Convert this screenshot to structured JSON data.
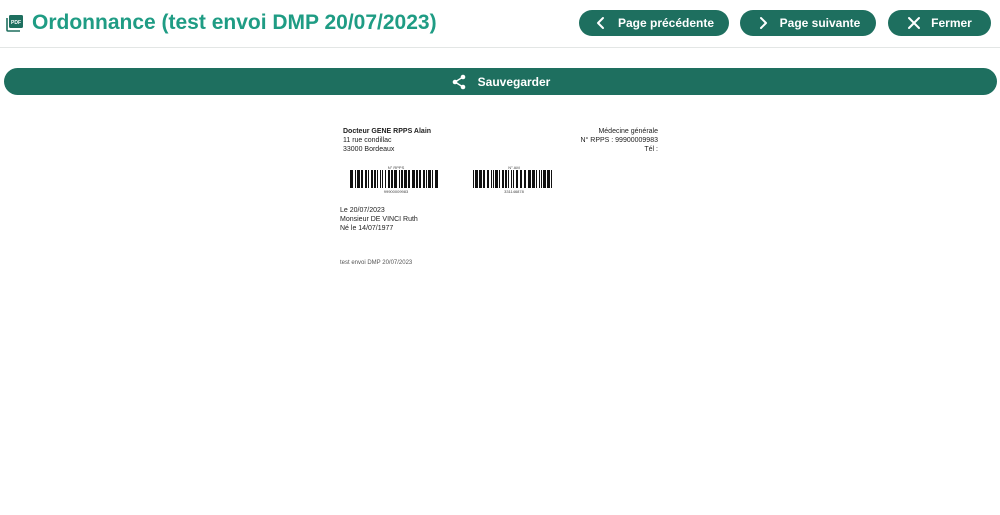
{
  "header": {
    "title": "Ordonnance (test envoi DMP 20/07/2023)",
    "icon": "pdf-file-icon"
  },
  "toolbar": {
    "prev_label": "Page précédente",
    "next_label": "Page suivante",
    "close_label": "Fermer",
    "save_label": "Sauvegarder"
  },
  "colors": {
    "title": "#1f9c84",
    "button": "#1e6f5f",
    "button_text": "#ffffff"
  },
  "document": {
    "doctor_name": "Docteur GENE RPPS Alain",
    "address_line1": "11 rue condillac",
    "address_line2": "33000 Bordeaux",
    "specialty": "Médecine générale",
    "rpps": "N° RPPS : 99900009983",
    "phone": "Tél :",
    "barcode1_label": "N° RPPS",
    "barcode1_number": "99900009983",
    "barcode2_label": "N° AM",
    "barcode2_number": "331146878",
    "date": "Le 20/07/2023",
    "patient": "Monsieur DE VINCI Ruth",
    "birth": "Né le 14/07/1977",
    "note": "test envoi DMP 20/07/2023"
  }
}
